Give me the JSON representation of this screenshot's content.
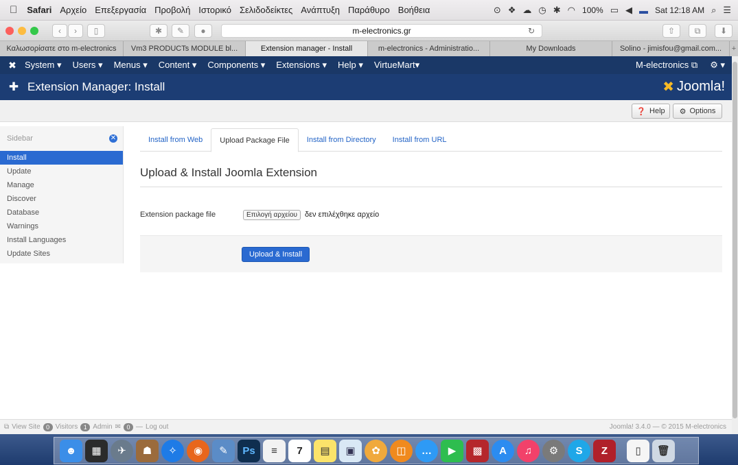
{
  "macbar": {
    "app": "Safari",
    "menus": [
      "Αρχείο",
      "Επεξεργασία",
      "Προβολή",
      "Ιστορικό",
      "Σελιδοδείκτες",
      "Ανάπτυξη",
      "Παράθυρο",
      "Βοήθεια"
    ],
    "battery": "100%",
    "clock": "Sat 12:18 AM"
  },
  "safari": {
    "url": "m-electronics.gr",
    "tabs": [
      "Καλωσορίσατε στο m-electronics",
      "Vm3 PRODUCTs MODULE bl...",
      "Extension manager - Install",
      "m-electronics - Administratio...",
      "My Downloads",
      "Solino - jimisfou@gmail.com..."
    ],
    "active_tab": 2
  },
  "jnav": {
    "items": [
      "System ▾",
      "Users ▾",
      "Menus ▾",
      "Content ▾",
      "Components ▾",
      "Extensions ▾",
      "Help ▾",
      "VirtueMart▾"
    ],
    "site": "M-electronics ⧉",
    "gear": "⚙ ▾"
  },
  "header": {
    "title": "Extension Manager: Install",
    "brand": "Joomla!"
  },
  "toolbar": {
    "help": "Help",
    "options": "Options"
  },
  "sidebar": {
    "heading": "Sidebar",
    "items": [
      "Install",
      "Update",
      "Manage",
      "Discover",
      "Database",
      "Warnings",
      "Install Languages",
      "Update Sites"
    ],
    "active": 0
  },
  "main": {
    "tabs": [
      "Install from Web",
      "Upload Package File",
      "Install from Directory",
      "Install from URL"
    ],
    "active_tab": 1,
    "heading": "Upload & Install Joomla Extension",
    "file_label": "Extension package file",
    "choose_button": "Επιλογή αρχείου",
    "no_file_text": "δεν επιλέχθηκε αρχείο",
    "upload_button": "Upload & Install"
  },
  "status": {
    "view_site": "View Site",
    "visitors_count": "0",
    "visitors_label": "Visitors",
    "admin_count": "1",
    "admin_label": "Admin",
    "messages_count": "0",
    "logout": "Log out",
    "footer": "Joomla! 3.4.0 — © 2015 M-electronics"
  },
  "colors": {
    "navbar": "#1a3867",
    "header": "#1c3d74",
    "accent": "#2a6ad1",
    "brand_mark": "#f6ba26"
  }
}
